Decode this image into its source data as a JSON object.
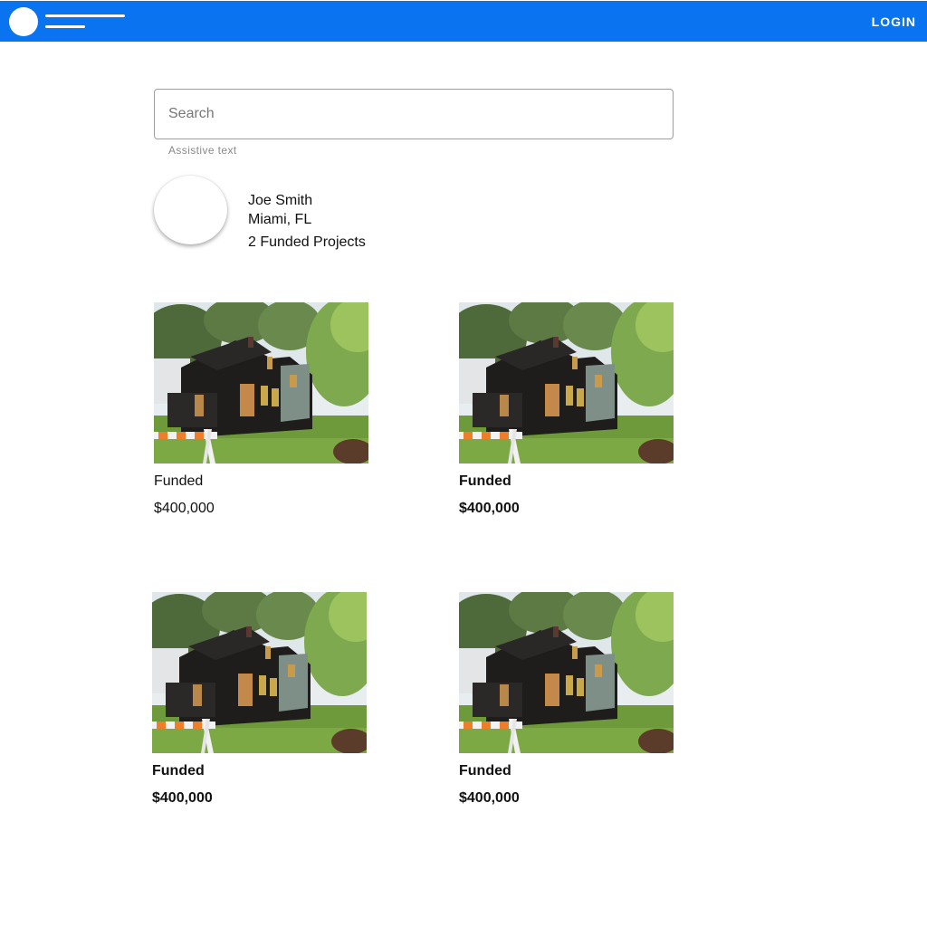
{
  "appbar": {
    "login_label": "LOGIN",
    "color": "#0a73f0"
  },
  "search": {
    "placeholder": "Search",
    "value": "",
    "assistive_text": "Assistive text"
  },
  "profile": {
    "name": "Joe Smith",
    "location": "Miami, FL",
    "funded_projects": "2 Funded Projects"
  },
  "projects": [
    {
      "status": "Funded",
      "amount": "$400,000",
      "image_icon": "burned-house-photo"
    },
    {
      "status": "Funded",
      "amount": "$400,000",
      "image_icon": "burned-house-photo"
    },
    {
      "status": "Funded",
      "amount": "$400,000",
      "image_icon": "burned-house-photo"
    },
    {
      "status": "Funded",
      "amount": "$400,000",
      "image_icon": "burned-house-photo"
    }
  ]
}
